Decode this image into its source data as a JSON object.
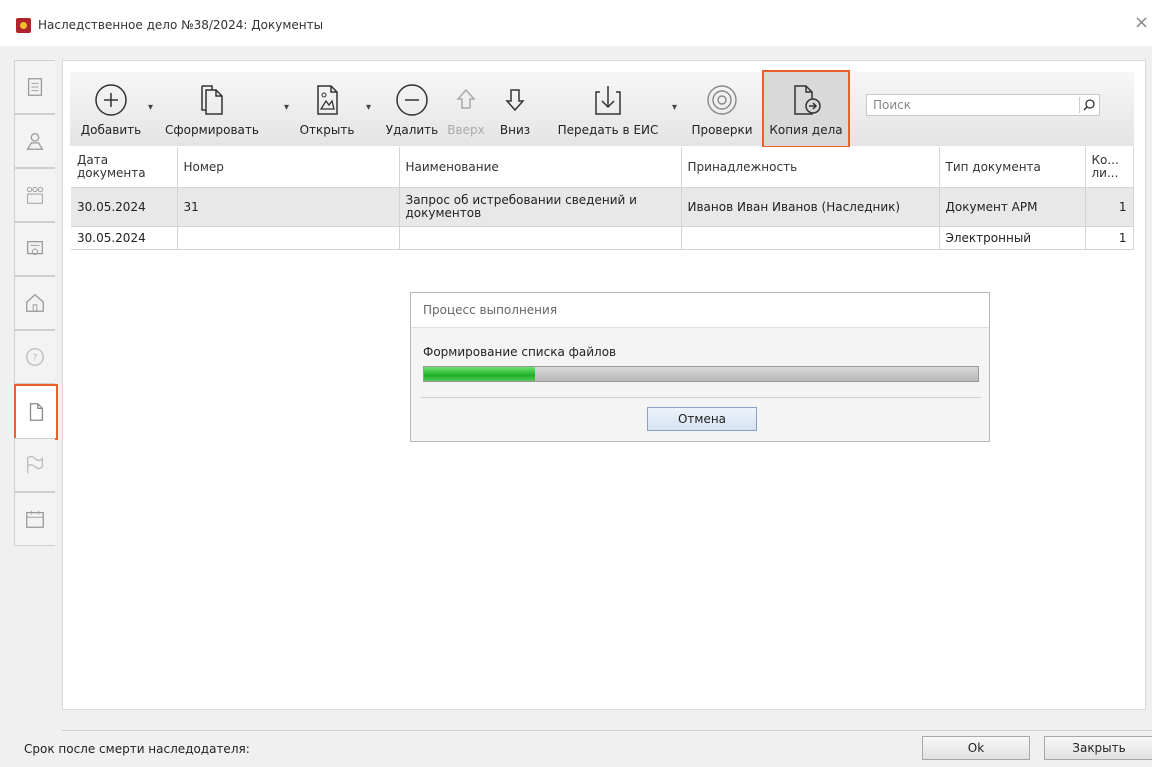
{
  "window": {
    "title": "Наследственное дело №38/2024: Документы",
    "close_glyph": "×"
  },
  "sidebar": {
    "items": [
      {
        "icon": "document-list-icon"
      },
      {
        "icon": "person-icon"
      },
      {
        "icon": "family-icon"
      },
      {
        "icon": "certificate-icon"
      },
      {
        "icon": "house-icon"
      },
      {
        "icon": "question-icon"
      },
      {
        "icon": "document-icon",
        "active": true
      },
      {
        "icon": "flag-icon"
      },
      {
        "icon": "calendar-icon"
      }
    ]
  },
  "toolbar": {
    "add": "Добавить",
    "generate": "Сформировать",
    "open": "Открыть",
    "delete": "Удалить",
    "up": "Вверх",
    "down": "Вниз",
    "transfer": "Передать в ЕИС",
    "checks": "Проверки",
    "copy_case": "Копия дела",
    "search_placeholder": "Поиск"
  },
  "table": {
    "headers": [
      "Дата документа",
      "Номер",
      "Наименование",
      "Принадлежность",
      "Тип документа",
      "Ко... ли..."
    ],
    "rows": [
      [
        "30.05.2024",
        "31",
        "Запрос об истребовании сведений и документов",
        "Иванов Иван Иванов (Наследник)",
        "Документ АРМ",
        "1"
      ],
      [
        "30.05.2024",
        "",
        "",
        "",
        "Электронный",
        "1"
      ]
    ]
  },
  "progress_dialog": {
    "title": "Процесс выполнения",
    "message": "Формирование списка файлов",
    "progress": 0.2,
    "cancel": "Отмена"
  },
  "footer": {
    "death_label": "Срок после смерти наследодателя:",
    "ok": "Ok",
    "close": "Закрыть"
  },
  "colors": {
    "highlight": "#e8612c",
    "progress": "#1eae28"
  }
}
